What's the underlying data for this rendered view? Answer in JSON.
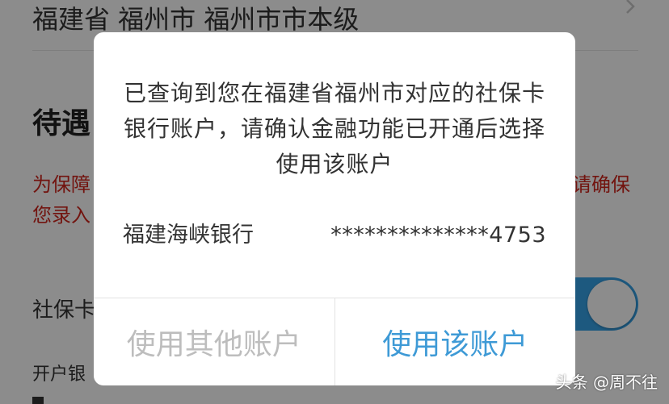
{
  "background": {
    "region": "福建省 福州市 福州市市本级",
    "section_title": "待遇",
    "warning_left_line1": "为保障",
    "warning_right_line1": "请确保",
    "warning_left_line2": "您录入",
    "card_label": "社保卡",
    "bank_label": "开户银"
  },
  "dialog": {
    "message": "已查询到您在福建省福州市对应的社保卡银行账户，请确认金融功能已开通后选择使用该账户",
    "account_bank": "福建海峡银行",
    "account_number": "**************4753",
    "other_account_label": "使用其他账户",
    "use_account_label": "使用该账户"
  },
  "watermark": "头条 @周不往",
  "colors": {
    "accent": "#3e9ad6",
    "toggle": "#36a3e8",
    "warning": "#d0251c",
    "disabled": "#bdbdbd"
  }
}
